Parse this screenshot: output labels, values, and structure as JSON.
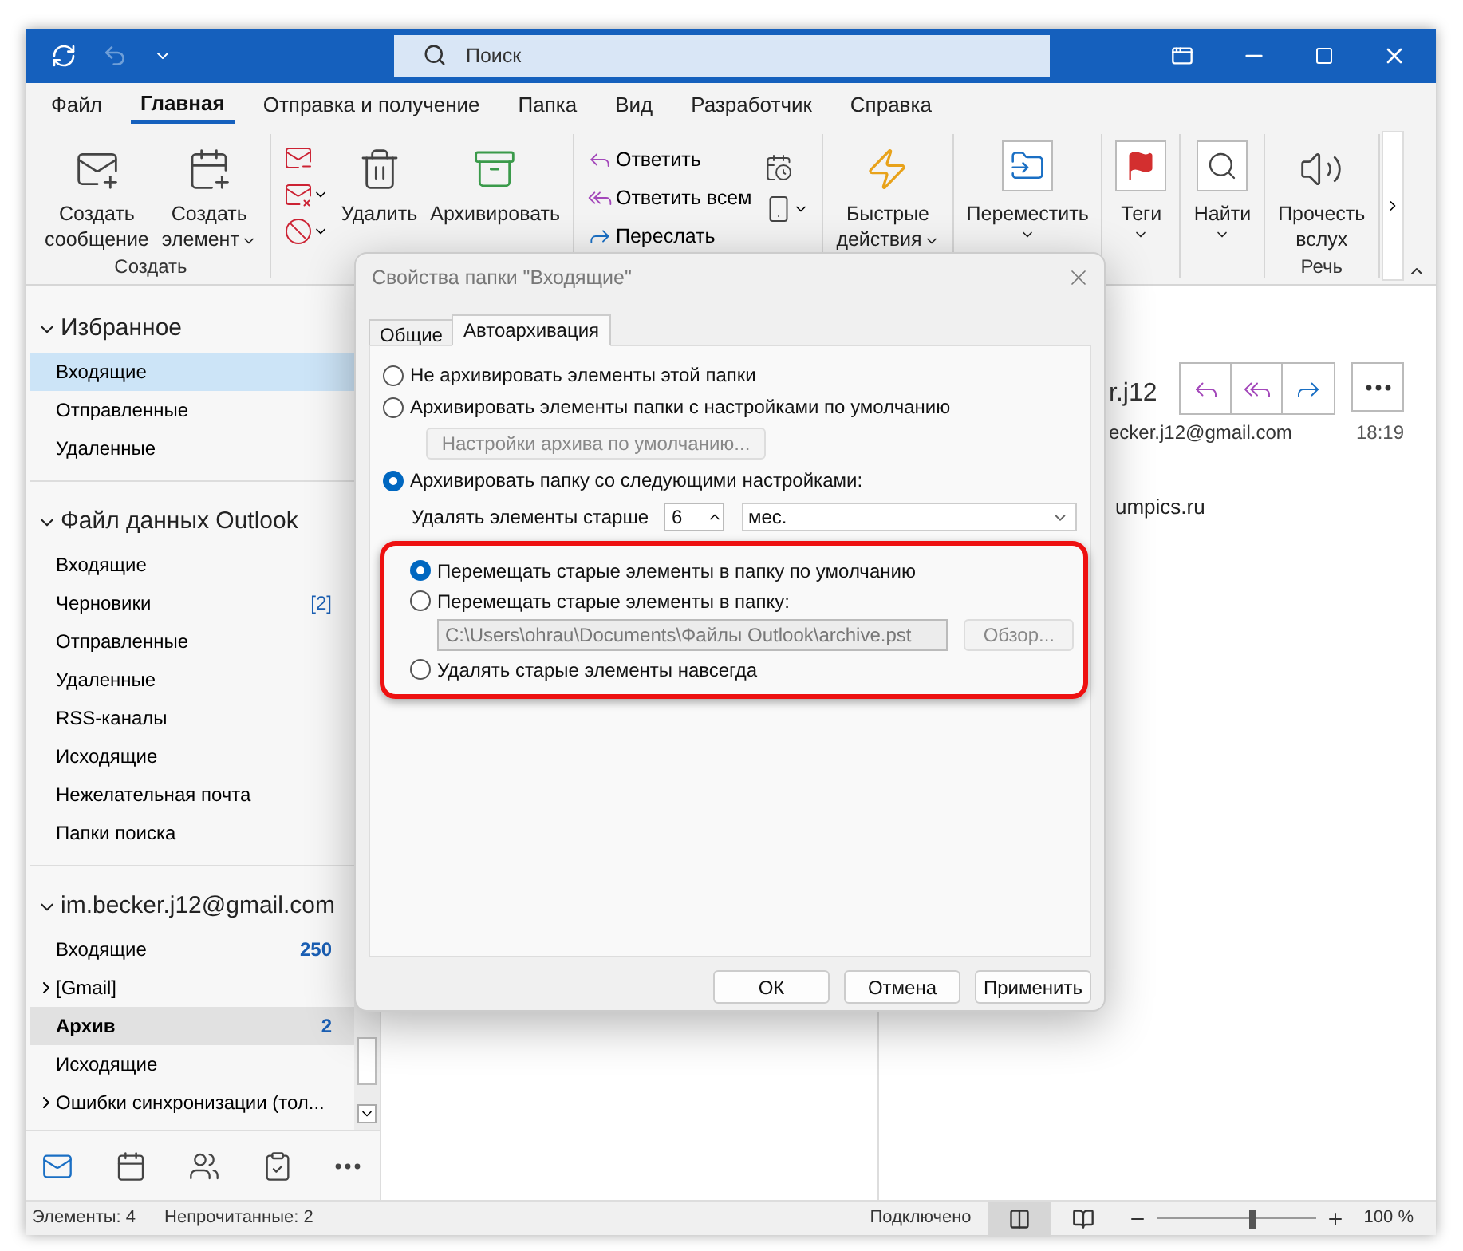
{
  "search": {
    "placeholder": "Поиск"
  },
  "menu_tabs": [
    {
      "label": "Файл",
      "selected": false
    },
    {
      "label": "Главная",
      "selected": true
    },
    {
      "label": "Отправка и получение",
      "selected": false
    },
    {
      "label": "Папка",
      "selected": false
    },
    {
      "label": "Вид",
      "selected": false
    },
    {
      "label": "Разработчик",
      "selected": false
    },
    {
      "label": "Справка",
      "selected": false
    }
  ],
  "ribbon": {
    "groups": [
      {
        "label": "Создать",
        "buttons": [
          {
            "kind": "new_mail",
            "label": "Создать\nсообщение",
            "dropdown": false
          },
          {
            "kind": "new_item",
            "label": "Создать\nэлемент",
            "dropdown": true
          }
        ]
      },
      {
        "buttons": [
          {
            "kind": "stack_delete"
          },
          {
            "kind": "delete",
            "label": "Удалить",
            "dropdown": false
          },
          {
            "kind": "archive",
            "label": "Архивировать",
            "dropdown": false
          }
        ]
      },
      {
        "buttons": [
          {
            "kind": "respond",
            "items": [
              {
                "kind": "reply",
                "label": "Ответить"
              },
              {
                "kind": "reply_all",
                "label": "Ответить всем"
              },
              {
                "kind": "forward",
                "label": "Переслать"
              }
            ]
          },
          {
            "kind": "stack_meeting"
          }
        ]
      },
      {
        "buttons": [
          {
            "kind": "quick",
            "label": "Быстрые\nдействия",
            "dropdown": true
          }
        ]
      },
      {
        "buttons": [
          {
            "kind": "move",
            "label": "Переместить",
            "dropdown": true
          }
        ]
      },
      {
        "buttons": [
          {
            "kind": "tags",
            "label": "Теги",
            "dropdown": true
          }
        ]
      },
      {
        "buttons": [
          {
            "kind": "find",
            "label": "Найти",
            "dropdown": true
          }
        ]
      },
      {
        "label": "Речь",
        "buttons": [
          {
            "kind": "read_aloud",
            "label": "Прочесть\nвслух",
            "dropdown": false
          }
        ]
      }
    ]
  },
  "sidebar": {
    "sections": [
      {
        "title": "Избранное",
        "expanded": true,
        "items": [
          {
            "kind": "folder",
            "label": "Входящие",
            "selected": true,
            "hovered": false
          },
          {
            "kind": "folder",
            "label": "Отправленные",
            "selected": false,
            "hovered": false
          },
          {
            "kind": "folder",
            "label": "Удаленные",
            "selected": false,
            "hovered": false
          }
        ]
      },
      {
        "title": "Файл данных Outlook",
        "expanded": true,
        "items": [
          {
            "kind": "folder",
            "label": "Входящие",
            "selected": false,
            "hovered": false
          },
          {
            "kind": "folder",
            "label": "Черновики",
            "count": "[2]",
            "count_bold": false,
            "selected": false,
            "hovered": false
          },
          {
            "kind": "folder",
            "label": "Отправленные",
            "selected": false,
            "hovered": false
          },
          {
            "kind": "folder",
            "label": "Удаленные",
            "selected": false,
            "hovered": false
          },
          {
            "kind": "folder",
            "label": "RSS-каналы",
            "selected": false,
            "hovered": false
          },
          {
            "kind": "folder",
            "label": "Исходящие",
            "selected": false,
            "hovered": false
          },
          {
            "kind": "folder",
            "label": "Нежелательная почта",
            "selected": false,
            "hovered": false
          },
          {
            "kind": "folder",
            "label": "Папки поиска",
            "selected": false,
            "hovered": false
          }
        ]
      },
      {
        "title": "im.becker.j12@gmail.com",
        "expanded": true,
        "items": [
          {
            "kind": "folder",
            "label": "Входящие",
            "count": "250",
            "count_bold": true,
            "selected": false,
            "hovered": false
          },
          {
            "kind": "group",
            "label": "[Gmail]",
            "expanded": false,
            "selected": false,
            "hovered": false
          },
          {
            "kind": "folder",
            "label": "Архив",
            "count": "2",
            "count_bold": true,
            "selected": false,
            "hovered": true
          },
          {
            "kind": "folder",
            "label": "Исходящие",
            "selected": false,
            "hovered": false
          },
          {
            "kind": "group",
            "label": "Ошибки синхронизации (тол...",
            "expanded": false,
            "selected": false,
            "hovered": false
          }
        ]
      }
    ]
  },
  "nav": [
    {
      "kind": "mail",
      "selected": true
    },
    {
      "kind": "calendar",
      "selected": false
    },
    {
      "kind": "people",
      "selected": false
    },
    {
      "kind": "tasks",
      "selected": false
    },
    {
      "kind": "more",
      "selected": false
    }
  ],
  "reading_pane": {
    "sender": "r.j12",
    "address": "ecker.j12@gmail.com",
    "time": "18:19",
    "body": "umpics.ru",
    "actions": [
      {
        "kind": "reply"
      },
      {
        "kind": "reply_all"
      },
      {
        "kind": "forward"
      },
      {
        "kind": "more"
      }
    ]
  },
  "status_bar": {
    "items": "Элементы: 4",
    "unread": "Непрочитанные: 2",
    "connection": "Подключено",
    "views": [
      {
        "kind": "normal",
        "selected": true
      },
      {
        "kind": "reading",
        "selected": false
      }
    ],
    "zoom": {
      "level": 0.6,
      "reading": "100 %"
    }
  },
  "dialog": {
    "title": "Свойства папки \"Входящие\"",
    "tabs": [
      {
        "label": "Общие",
        "selected": false
      },
      {
        "label": "Автоархивация",
        "selected": true
      }
    ],
    "options": [
      {
        "label": "Не архивировать элементы этой папки",
        "selected": false
      },
      {
        "label": "Архивировать элементы папки с настройками по умолчанию",
        "selected": false,
        "button": {
          "label": "Настройки архива по умолчанию...",
          "disabled": true
        }
      },
      {
        "label": "Архивировать папку со следующими настройками:",
        "selected": true
      }
    ],
    "age": {
      "label": "Удалять элементы старше",
      "value": "6",
      "unit": "мес."
    },
    "highlighted": true,
    "sub_options": [
      {
        "label": "Перемещать старые элементы в папку по умолчанию",
        "selected": true
      },
      {
        "label": "Перемещать старые элементы в папку:",
        "selected": false,
        "path": {
          "value": "C:\\Users\\ohrau\\Documents\\Файлы Outlook\\archive.pst",
          "disabled": true
        },
        "browse": {
          "label": "Обзор...",
          "disabled": true
        }
      },
      {
        "label": "Удалять старые элементы навсегда",
        "selected": false
      }
    ],
    "buttons": [
      "ОК",
      "Отмена",
      "Применить"
    ]
  }
}
